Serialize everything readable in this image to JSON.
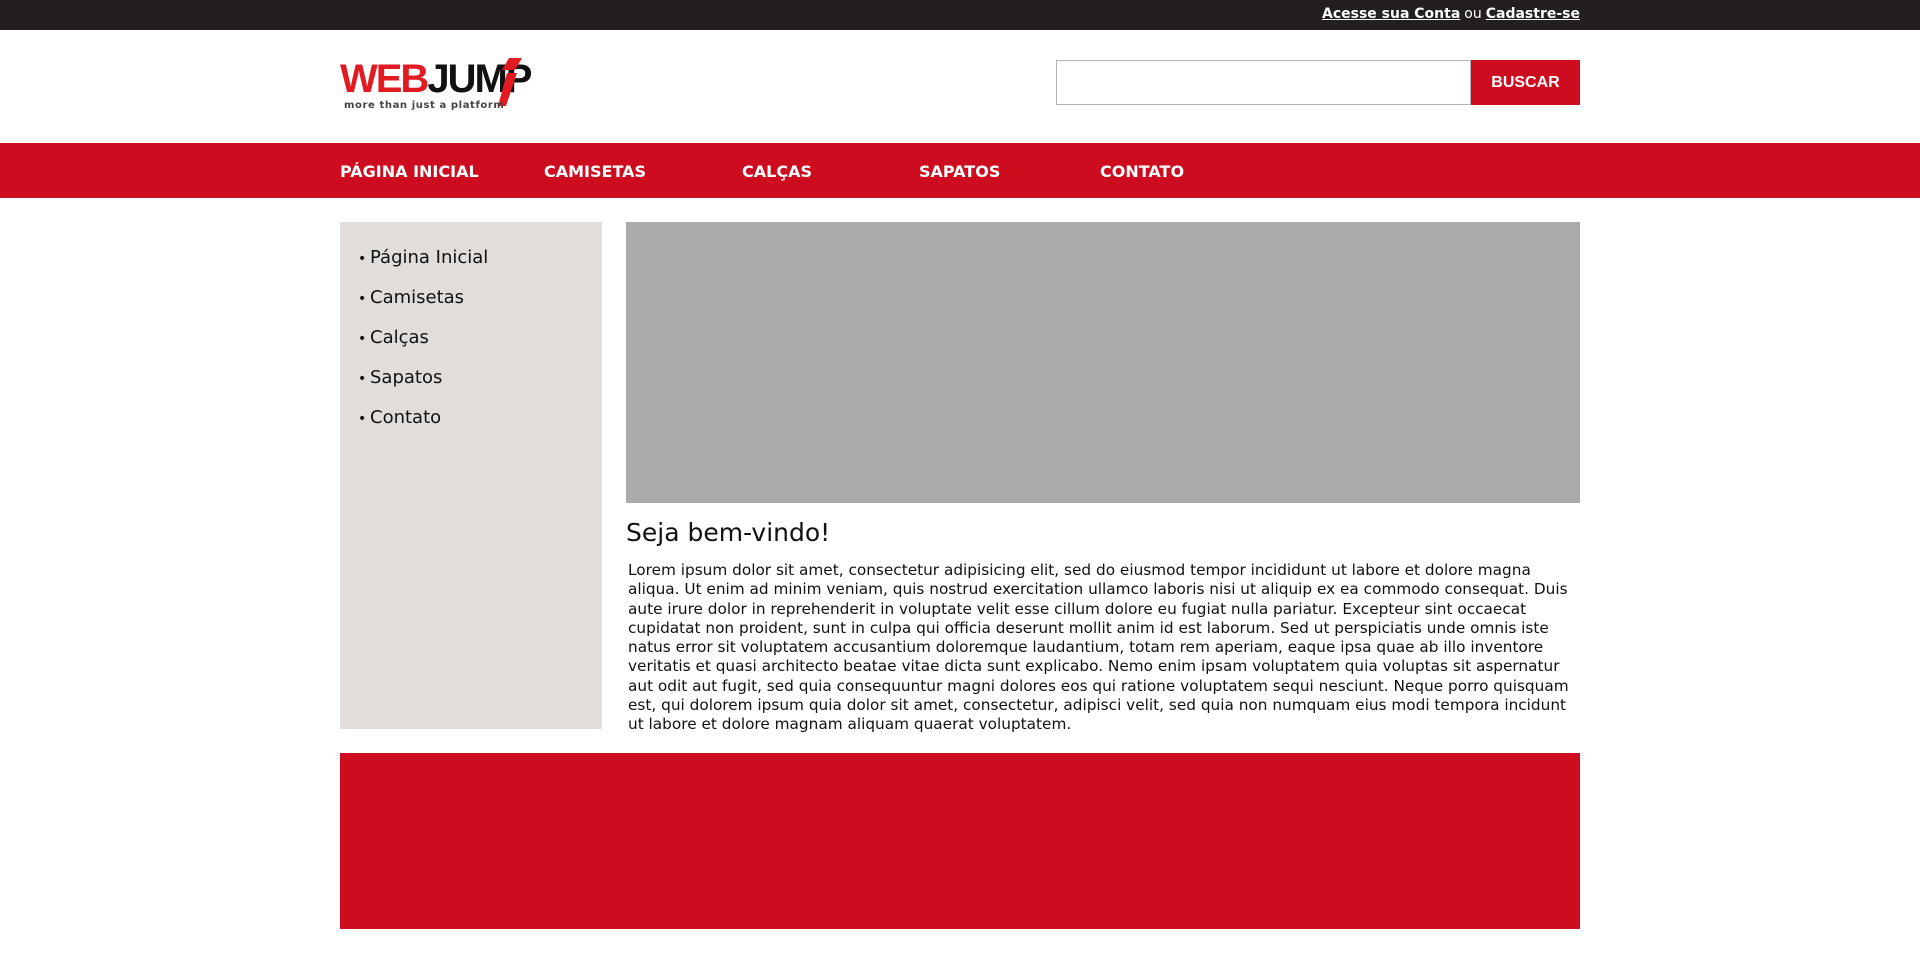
{
  "topbar": {
    "login_link": "Acesse sua Conta",
    "separator": "ou",
    "register_link": "Cadastre-se"
  },
  "header": {
    "logo": {
      "word_part1": "WEB",
      "word_part2": "JUMP",
      "tagline": "more than just a platform"
    },
    "search": {
      "value": "",
      "placeholder": "",
      "button_label": "BUSCAR"
    }
  },
  "mainnav": {
    "items": [
      {
        "label": "PÁGINA INICIAL"
      },
      {
        "label": "CAMISETAS"
      },
      {
        "label": "CALÇAS"
      },
      {
        "label": "SAPATOS"
      },
      {
        "label": "CONTATO"
      }
    ]
  },
  "sidebar": {
    "items": [
      {
        "label": "Página Inicial"
      },
      {
        "label": "Camisetas"
      },
      {
        "label": "Calças"
      },
      {
        "label": "Sapatos"
      },
      {
        "label": "Contato"
      }
    ]
  },
  "content": {
    "title": "Seja bem-vindo!",
    "body": "Lorem ipsum dolor sit amet, consectetur adipisicing elit, sed do eiusmod tempor incididunt ut labore et dolore magna aliqua. Ut enim ad minim veniam, quis nostrud exercitation ullamco laboris nisi ut aliquip ex ea commodo consequat. Duis aute irure dolor in reprehenderit in voluptate velit esse cillum dolore eu fugiat nulla pariatur. Excepteur sint occaecat cupidatat non proident, sunt in culpa qui officia deserunt mollit anim id est laborum. Sed ut perspiciatis unde omnis iste natus error sit voluptatem accusantium doloremque laudantium, totam rem aperiam, eaque ipsa quae ab illo inventore veritatis et quasi architecto beatae vitae dicta sunt explicabo. Nemo enim ipsam voluptatem quia voluptas sit aspernatur aut odit aut fugit, sed quia consequuntur magni dolores eos qui ratione voluptatem sequi nesciunt. Neque porro quisquam est, qui dolorem ipsum quia dolor sit amet, consectetur, adipisci velit, sed quia non numquam eius modi tempora incidunt ut labore et dolore magnam aliquam quaerat voluptatem."
  },
  "colors": {
    "brand_red": "#cd0d1f",
    "topbar_dark": "#231f20",
    "sidebar_bg": "#e0ddda",
    "banner_gray": "#aaaaaa"
  },
  "icons": {
    "logo_mark": "red-slash-i-mark"
  }
}
